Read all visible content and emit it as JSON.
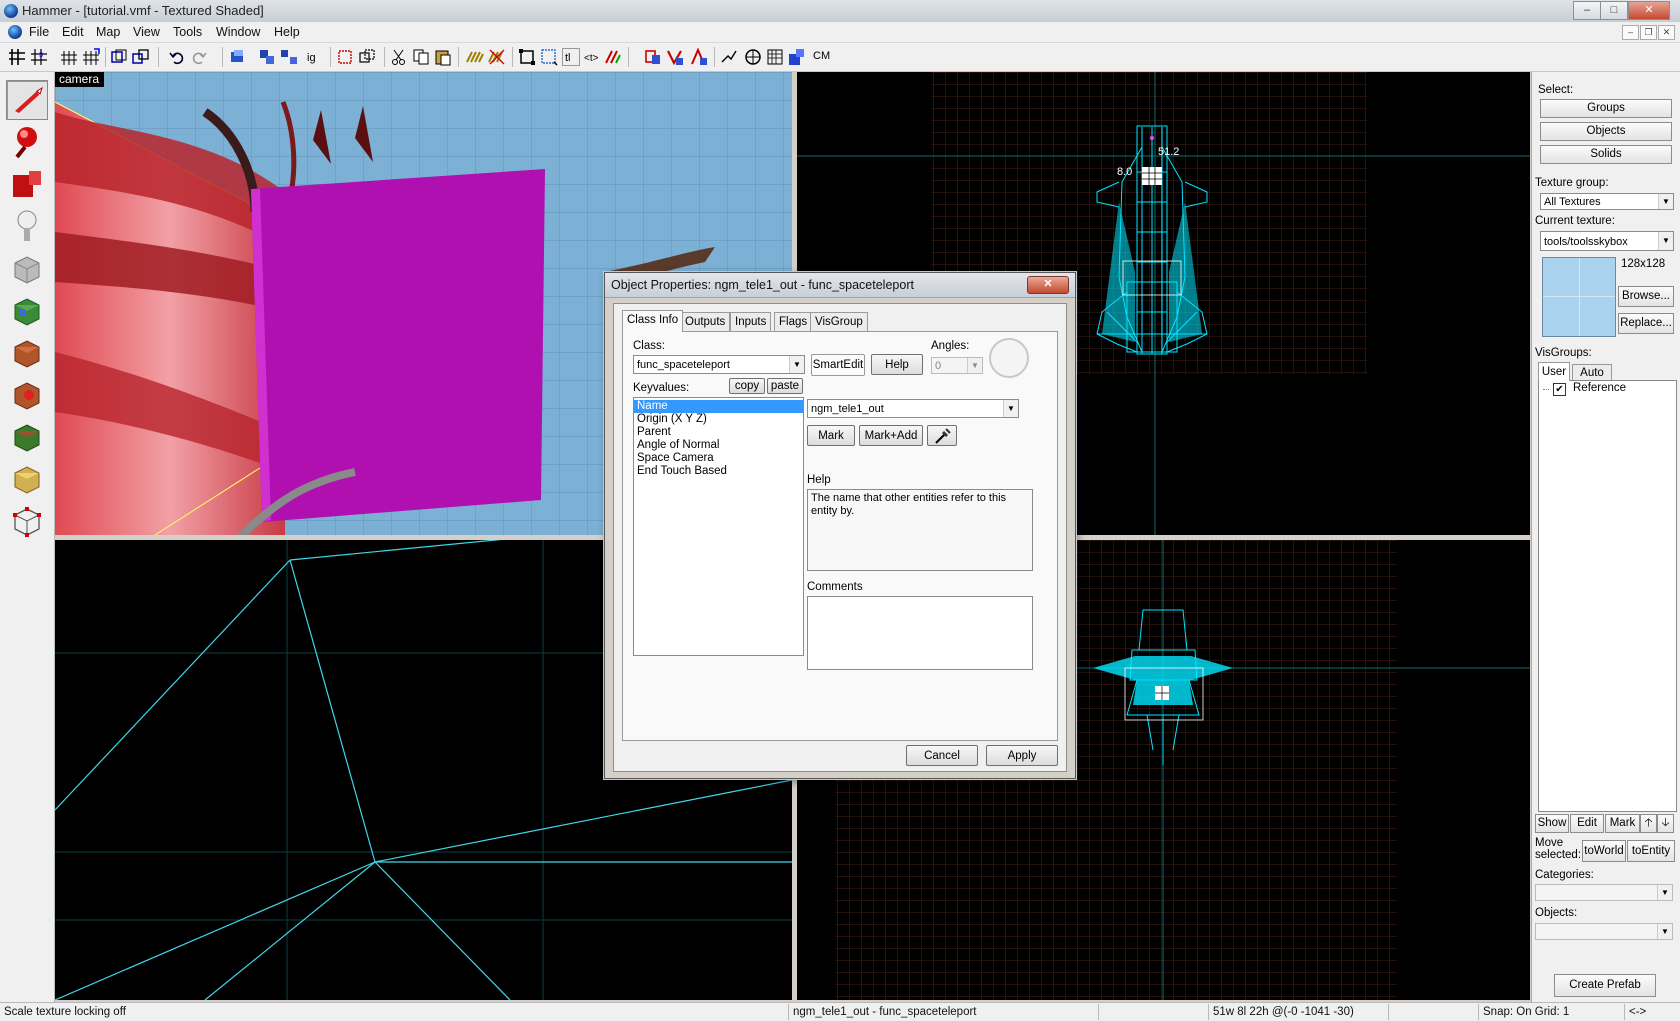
{
  "window": {
    "title": "Hammer - [tutorial.vmf - Textured Shaded]",
    "controls": [
      "–",
      "□",
      "✕"
    ]
  },
  "menubar": {
    "items": [
      "File",
      "Edit",
      "Map",
      "View",
      "Tools",
      "Window",
      "Help"
    ]
  },
  "toolbar": {
    "cm_label": "CM"
  },
  "viewports": {
    "camera_label": "camera",
    "top_dims": {
      "width_label": "51.2",
      "height_label": "8.0"
    }
  },
  "right_panel": {
    "select_label": "Select:",
    "groups_button": "Groups",
    "objects_button": "Objects",
    "solids_button": "Solids",
    "texture_group_label": "Texture group:",
    "texture_group_value": "All Textures",
    "current_texture_label": "Current texture:",
    "current_texture_value": "tools/toolsskybox",
    "texture_size": "128x128",
    "browse_button": "Browse...",
    "replace_button": "Replace...",
    "visgroups_label": "VisGroups:",
    "visgroup_tabs": [
      "User",
      "Auto"
    ],
    "visgroup_items": [
      {
        "label": "Reference",
        "checked": true
      }
    ],
    "show_button": "Show",
    "edit_button": "Edit",
    "mark_button": "Mark",
    "up_button": "🡡",
    "down_button": "🡣",
    "move_selected_label": "Move selected:",
    "to_world_button": "toWorld",
    "to_entity_button": "toEntity",
    "categories_label": "Categories:",
    "objects_label": "Objects:",
    "create_prefab_button": "Create Prefab"
  },
  "dialog": {
    "title": "Object Properties: ngm_tele1_out - func_spaceteleport",
    "close_label": "✕",
    "tabs": [
      "Class Info",
      "Outputs",
      "Inputs",
      "Flags",
      "VisGroup"
    ],
    "class_label": "Class:",
    "class_value": "func_spaceteleport",
    "smartedit_label": "SmartEdit",
    "help_button": "Help",
    "angles_label": "Angles:",
    "angles_value": "0",
    "keyvalues_label": "Keyvalues:",
    "copy_button": "copy",
    "paste_button": "paste",
    "keyvalues": [
      "Name",
      "Origin (X Y Z)",
      "Parent",
      "Angle of Normal",
      "Space Camera",
      "End Touch Based"
    ],
    "selected_keyvalue_index": 0,
    "value_field": "ngm_tele1_out",
    "mark_button": "Mark",
    "mark_add_button": "Mark+Add",
    "help_label": "Help",
    "help_text": "The name that other entities refer to this entity by.",
    "comments_label": "Comments",
    "comments_value": "",
    "cancel_button": "Cancel",
    "apply_button": "Apply"
  },
  "statusbar": {
    "message": "Scale texture locking off",
    "selection": "ngm_tele1_out - func_spaceteleport",
    "size": "51w 8l 22h @(-0 -1041 -30)",
    "snap": "Snap: On Grid: 1",
    "nav": "<->"
  },
  "colors": {
    "wireframe": "#00e5ff",
    "grid": "#5a2a1a",
    "brush_magenta": "#b000b0",
    "selection": "#3399ff"
  }
}
